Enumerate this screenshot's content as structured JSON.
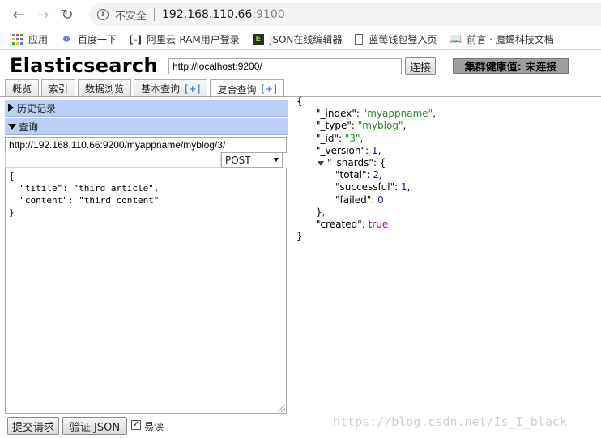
{
  "browser": {
    "security_label": "不安全",
    "url_host": "192.168.110.66",
    "url_port": ":9100",
    "bookmarks": [
      {
        "label": "应用",
        "icon": "apps-grid-icon"
      },
      {
        "label": "百度一下",
        "icon": "baidu-paw-icon"
      },
      {
        "label": "阿里云-RAM用户登录",
        "icon": "aliyun-icon"
      },
      {
        "label": "JSON在线编辑器",
        "icon": "json-e-icon"
      },
      {
        "label": "蓝莓钱包登入页",
        "icon": "page-icon"
      },
      {
        "label": "前言 · 魔蝎科技文档",
        "icon": "book-icon"
      }
    ]
  },
  "header": {
    "title": "Elasticsearch",
    "connection_url": "http://localhost:9200/",
    "connect_label": "连接",
    "health_label": "集群健康值: 未连接"
  },
  "tabs": [
    {
      "label": "概览",
      "plus": ""
    },
    {
      "label": "索引",
      "plus": ""
    },
    {
      "label": "数据浏览",
      "plus": ""
    },
    {
      "label": "基本查询",
      "plus": "[+]"
    },
    {
      "label": "复合查询",
      "plus": "[+]"
    }
  ],
  "left": {
    "history_label": "历史记录",
    "query_label": "查询",
    "request_path": "http://192.168.110.66:9200/myappname/myblog/3/",
    "method": "POST",
    "request_body": "{\n  \"titile\": \"third article\",\n  \"content\": \"third content\"\n}",
    "submit_label": "提交请求",
    "validate_label": "验证 JSON",
    "readable_label": "易读",
    "readable_checked": true
  },
  "response": {
    "index_key": "\"_index\"",
    "index_val": "\"myappname\"",
    "type_key": "\"_type\"",
    "type_val": "\"myblog\"",
    "id_key": "\"_id\"",
    "id_val": "\"3\"",
    "version_key": "\"_version\"",
    "version_val": "1",
    "shards_key": "\"_shards\"",
    "total_key": "\"total\"",
    "total_val": "2",
    "successful_key": "\"successful\"",
    "successful_val": "1",
    "failed_key": "\"failed\"",
    "failed_val": "0",
    "created_key": "\"created\"",
    "created_val": "true"
  },
  "watermark": "https://blog.csdn.net/Is_I_black"
}
